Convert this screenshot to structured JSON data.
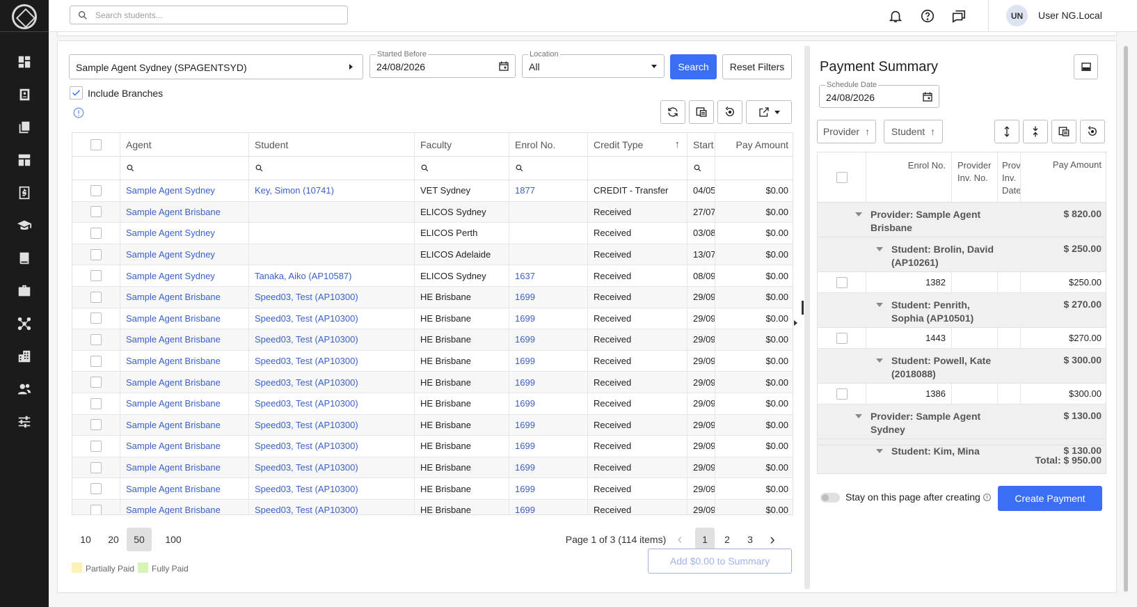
{
  "topbar": {
    "search_placeholder": "Search students...",
    "avatar_initials": "UN",
    "username": "User NG.Local"
  },
  "sidebar": {
    "items": [
      "dashboard-icon",
      "contacts-icon",
      "documents-icon",
      "layout-icon",
      "invoice-icon",
      "school-icon",
      "book-icon",
      "briefcase-icon",
      "network-icon",
      "buildings-icon",
      "people-icon",
      "settings-sliders-icon"
    ]
  },
  "filters": {
    "agent": "Sample Agent Sydney (SPAGENTSYD)",
    "started_before_label": "Started Before",
    "started_before": "24/08/2026",
    "location_label": "Location",
    "location": "All",
    "search_label": "Search",
    "reset_label": "Reset Filters",
    "include_branches": "Include Branches"
  },
  "grid": {
    "columns": [
      "Agent",
      "Student",
      "Faculty",
      "Enrol No.",
      "Credit Type",
      "Start",
      "Pay Amount"
    ],
    "rows": [
      {
        "agent": "Sample Agent Sydney",
        "student": "Key, Simon (10741)",
        "faculty": "VET Sydney",
        "enrol": "1877",
        "credit": "CREDIT - Transfer",
        "start": "04/05",
        "amount": "$0.00"
      },
      {
        "agent": "Sample Agent Brisbane",
        "student": "",
        "faculty": "ELICOS Sydney",
        "enrol": "",
        "credit": "Received",
        "start": "27/07",
        "amount": "$0.00"
      },
      {
        "agent": "Sample Agent Sydney",
        "student": "",
        "faculty": "ELICOS Perth",
        "enrol": "",
        "credit": "Received",
        "start": "03/08",
        "amount": "$0.00"
      },
      {
        "agent": "Sample Agent Sydney",
        "student": "",
        "faculty": "ELICOS Adelaide",
        "enrol": "",
        "credit": "Received",
        "start": "13/07",
        "amount": "$0.00"
      },
      {
        "agent": "Sample Agent Sydney",
        "student": "Tanaka, Aiko (AP10587)",
        "faculty": "ELICOS Sydney",
        "enrol": "1637",
        "credit": "Received",
        "start": "08/09",
        "amount": "$0.00"
      },
      {
        "agent": "Sample Agent Brisbane",
        "student": "Speed03, Test (AP10300)",
        "faculty": "HE Brisbane",
        "enrol": "1699",
        "credit": "Received",
        "start": "29/09",
        "amount": "$0.00"
      },
      {
        "agent": "Sample Agent Brisbane",
        "student": "Speed03, Test (AP10300)",
        "faculty": "HE Brisbane",
        "enrol": "1699",
        "credit": "Received",
        "start": "29/09",
        "amount": "$0.00"
      },
      {
        "agent": "Sample Agent Brisbane",
        "student": "Speed03, Test (AP10300)",
        "faculty": "HE Brisbane",
        "enrol": "1699",
        "credit": "Received",
        "start": "29/09",
        "amount": "$0.00"
      },
      {
        "agent": "Sample Agent Brisbane",
        "student": "Speed03, Test (AP10300)",
        "faculty": "HE Brisbane",
        "enrol": "1699",
        "credit": "Received",
        "start": "29/09",
        "amount": "$0.00"
      },
      {
        "agent": "Sample Agent Brisbane",
        "student": "Speed03, Test (AP10300)",
        "faculty": "HE Brisbane",
        "enrol": "1699",
        "credit": "Received",
        "start": "29/09",
        "amount": "$0.00"
      },
      {
        "agent": "Sample Agent Brisbane",
        "student": "Speed03, Test (AP10300)",
        "faculty": "HE Brisbane",
        "enrol": "1699",
        "credit": "Received",
        "start": "29/09",
        "amount": "$0.00"
      },
      {
        "agent": "Sample Agent Brisbane",
        "student": "Speed03, Test (AP10300)",
        "faculty": "HE Brisbane",
        "enrol": "1699",
        "credit": "Received",
        "start": "29/09",
        "amount": "$0.00"
      },
      {
        "agent": "Sample Agent Brisbane",
        "student": "Speed03, Test (AP10300)",
        "faculty": "HE Brisbane",
        "enrol": "1699",
        "credit": "Received",
        "start": "29/09",
        "amount": "$0.00"
      },
      {
        "agent": "Sample Agent Brisbane",
        "student": "Speed03, Test (AP10300)",
        "faculty": "HE Brisbane",
        "enrol": "1699",
        "credit": "Received",
        "start": "29/09",
        "amount": "$0.00"
      },
      {
        "agent": "Sample Agent Brisbane",
        "student": "Speed03, Test (AP10300)",
        "faculty": "HE Brisbane",
        "enrol": "1699",
        "credit": "Received",
        "start": "29/09",
        "amount": "$0.00"
      },
      {
        "agent": "Sample Agent Brisbane",
        "student": "Speed03, Test (AP10300)",
        "faculty": "HE Brisbane",
        "enrol": "1699",
        "credit": "Received",
        "start": "29/09",
        "amount": "$0.00"
      }
    ]
  },
  "pagination": {
    "sizes": [
      "10",
      "20",
      "50",
      "100"
    ],
    "selected_size": "50",
    "info": "Page 1 of 3 (114 items)",
    "pages": [
      "1",
      "2",
      "3"
    ],
    "current_page": "1"
  },
  "legend": {
    "partial": "Partially Paid",
    "partial_color": "#fdf1b3",
    "full": "Fully Paid",
    "full_color": "#d5f5b5"
  },
  "add_to_summary": "Add $0.00 to Summary",
  "summary": {
    "title": "Payment Summary",
    "schedule_label": "Schedule Date",
    "schedule_date": "24/08/2026",
    "group_chips": [
      "Provider",
      "Student"
    ],
    "columns": [
      "Enrol No.",
      "Provider Inv. No.",
      "Prov Inv. Date",
      "Pay Amount"
    ],
    "rows": [
      {
        "kind": "provider",
        "label": "Provider: Sample Agent Brisbane",
        "amount": "$ 820.00"
      },
      {
        "kind": "student",
        "label": "Student: Brolin, David (AP10261)",
        "amount": "$ 250.00"
      },
      {
        "kind": "item",
        "enrol": "1382",
        "amount": "$250.00"
      },
      {
        "kind": "student",
        "label": "Student: Penrith, Sophia (AP10501)",
        "amount": "$ 270.00"
      },
      {
        "kind": "item",
        "enrol": "1443",
        "amount": "$270.00"
      },
      {
        "kind": "student",
        "label": "Student: Powell, Kate (2018088)",
        "amount": "$ 300.00"
      },
      {
        "kind": "item",
        "enrol": "1386",
        "amount": "$300.00"
      },
      {
        "kind": "provider",
        "label": "Provider: Sample Agent Sydney",
        "amount": "$ 130.00"
      },
      {
        "kind": "student",
        "label": "Student: Kim, Mina",
        "amount": "$ 130.00"
      }
    ],
    "total": "Total: $ 950.00",
    "stay_label": "Stay on this page after creating",
    "create_label": "Create Payment"
  },
  "colors": {
    "accent": "#3a6ff5",
    "link": "#3a5fc9",
    "sidebar": "#1b1b1b"
  }
}
